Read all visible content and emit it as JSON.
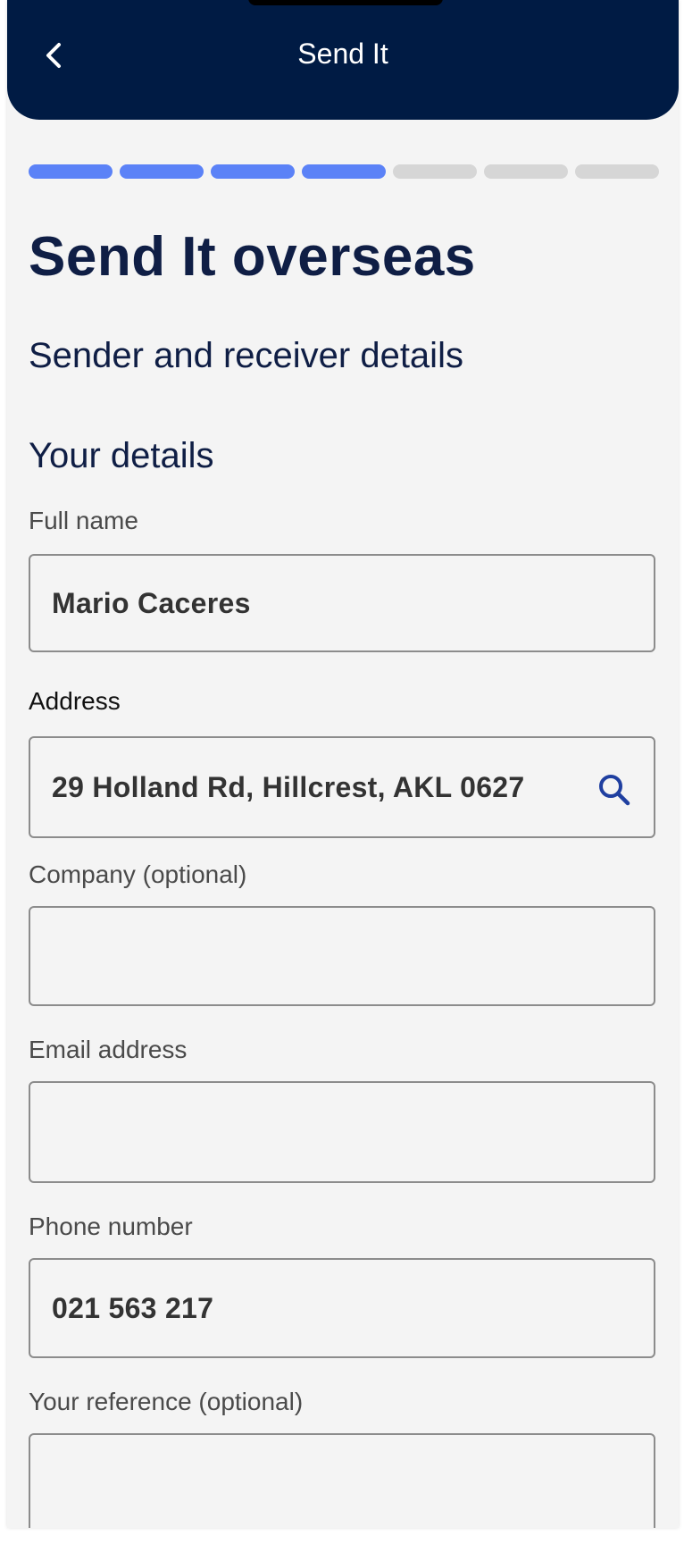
{
  "header": {
    "title": "Send It",
    "back_icon": "chevron-left-icon",
    "background_color": "#001b44"
  },
  "progress": {
    "steps_total": 7,
    "steps_completed": 4,
    "active_color": "#5b82f7",
    "inactive_color": "#d6d6d6"
  },
  "page": {
    "title": "Send It overseas",
    "subtitle": "Sender and receiver details",
    "section_title": "Your details"
  },
  "form": {
    "full_name": {
      "label": "Full name",
      "value": "Mario Caceres"
    },
    "address": {
      "label": "Address",
      "value": "29 Holland Rd, Hillcrest, AKL 0627",
      "icon": "search-icon",
      "icon_color": "#1f3fa0"
    },
    "company": {
      "label": "Company (optional)",
      "value": ""
    },
    "email": {
      "label": "Email address",
      "value": ""
    },
    "phone": {
      "label": "Phone number",
      "value": "021 563 217"
    },
    "reference": {
      "label": "Your reference (optional)",
      "value": ""
    }
  }
}
